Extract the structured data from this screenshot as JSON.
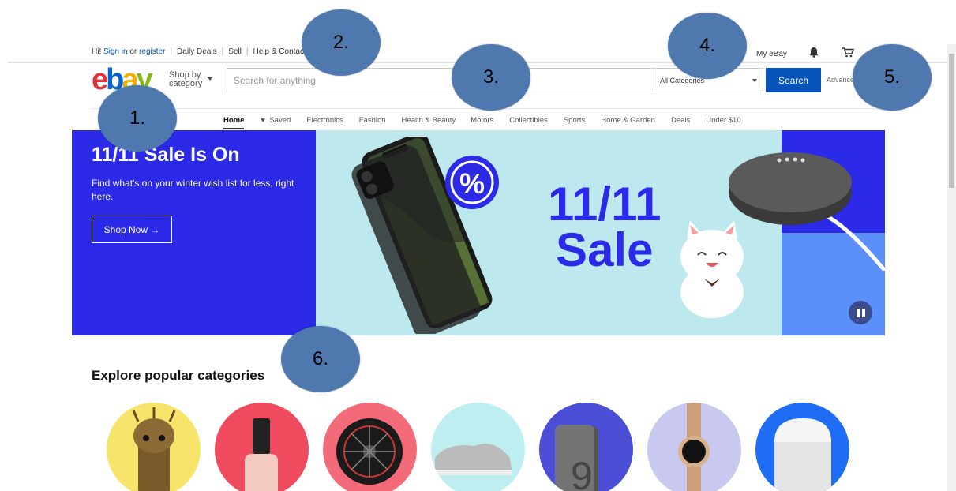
{
  "topbar": {
    "greeting": "Hi!",
    "sign_in": "Sign in",
    "or": "or",
    "register": "register",
    "daily_deals": "Daily Deals",
    "sell": "Sell",
    "help": "Help & Contact",
    "my_ebay": "My eBay"
  },
  "logo": {
    "e": "e",
    "b": "b",
    "a": "a",
    "y": "y"
  },
  "shop_by": {
    "line1": "Shop by",
    "line2": "category"
  },
  "search": {
    "placeholder": "Search for anything",
    "category": "All Categories",
    "button": "Search",
    "advanced": "Advanced"
  },
  "nav": {
    "items": [
      "Home",
      "Saved",
      "Electronics",
      "Fashion",
      "Health & Beauty",
      "Motors",
      "Collectibles",
      "Sports",
      "Home & Garden",
      "Deals",
      "Under $10"
    ]
  },
  "banner": {
    "title": "11/11 Sale Is On",
    "subtitle": "Find what's on your winter wish list for less, right here.",
    "cta": "Shop Now →",
    "big_line1": "11/11",
    "big_line2": "Sale"
  },
  "explore": {
    "title": "Explore popular categories"
  },
  "callouts": [
    "1.",
    "2.",
    "3.",
    "4.",
    "5.",
    "6."
  ],
  "colors": {
    "brand_blue": "#0654ba",
    "banner_blue": "#2a2ae8",
    "callout": "#4f79ae"
  }
}
